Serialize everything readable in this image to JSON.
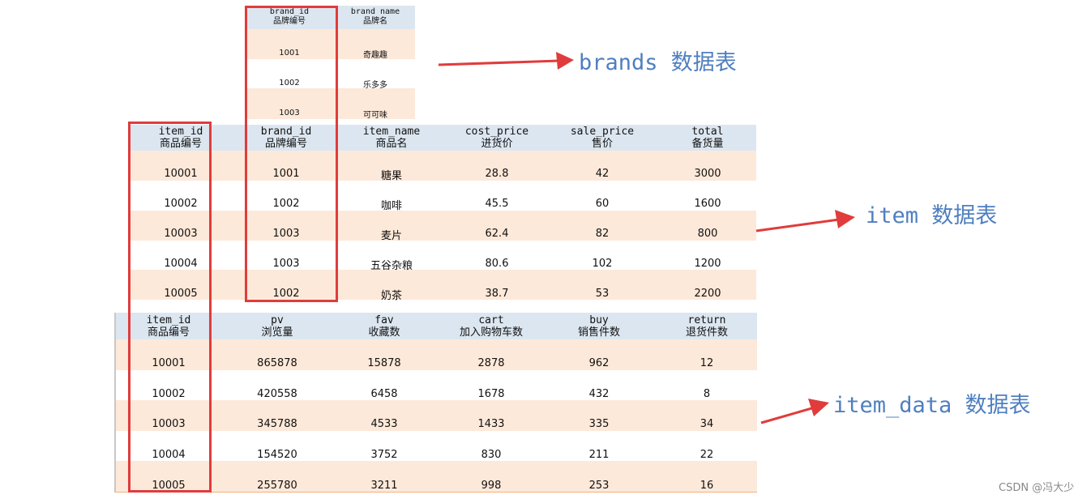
{
  "brands": {
    "label": "brands 数据表",
    "headers": [
      {
        "en": "brand_id",
        "zh": "品牌编号"
      },
      {
        "en": "brand name",
        "zh": "品牌名"
      }
    ],
    "rows": [
      [
        "1001",
        "奇趣趣"
      ],
      [
        "1002",
        "乐多多"
      ],
      [
        "1003",
        "可可味"
      ]
    ]
  },
  "item": {
    "label": "item 数据表",
    "headers": [
      {
        "en": "item_id",
        "zh": "商品编号"
      },
      {
        "en": "brand_id",
        "zh": "品牌编号"
      },
      {
        "en": "item_name",
        "zh": "商品名"
      },
      {
        "en": "cost_price",
        "zh": "进货价"
      },
      {
        "en": "sale_price",
        "zh": "售价"
      },
      {
        "en": "total",
        "zh": "备货量"
      }
    ],
    "rows": [
      [
        "10001",
        "1001",
        "糖果",
        "28.8",
        "42",
        "3000"
      ],
      [
        "10002",
        "1002",
        "咖啡",
        "45.5",
        "60",
        "1600"
      ],
      [
        "10003",
        "1003",
        "麦片",
        "62.4",
        "82",
        "800"
      ],
      [
        "10004",
        "1003",
        "五谷杂粮",
        "80.6",
        "102",
        "1200"
      ],
      [
        "10005",
        "1002",
        "奶茶",
        "38.7",
        "53",
        "2200"
      ]
    ]
  },
  "item_data": {
    "label": "item_data 数据表",
    "headers": [
      {
        "en": "item_id",
        "zh": "商品编号"
      },
      {
        "en": "pv",
        "zh": "浏览量"
      },
      {
        "en": "fav",
        "zh": "收藏数"
      },
      {
        "en": "cart",
        "zh": "加入购物车数"
      },
      {
        "en": "buy",
        "zh": "销售件数"
      },
      {
        "en": "return",
        "zh": "退货件数"
      }
    ],
    "rows": [
      [
        "10001",
        "865878",
        "15878",
        "2878",
        "962",
        "12"
      ],
      [
        "10002",
        "420558",
        "6458",
        "1678",
        "432",
        "8"
      ],
      [
        "10003",
        "345788",
        "4533",
        "1433",
        "335",
        "34"
      ],
      [
        "10004",
        "154520",
        "3752",
        "830",
        "211",
        "22"
      ],
      [
        "10005",
        "255780",
        "3211",
        "998",
        "253",
        "16"
      ]
    ]
  },
  "watermark": "CSDN @冯大少",
  "colors": {
    "header_bg": "#dce6f0",
    "row_alt_bg": "#fde9d9",
    "highlight_box": "#e03c3c",
    "label_text": "#4f7fc0",
    "arrow": "#e03c3c"
  }
}
